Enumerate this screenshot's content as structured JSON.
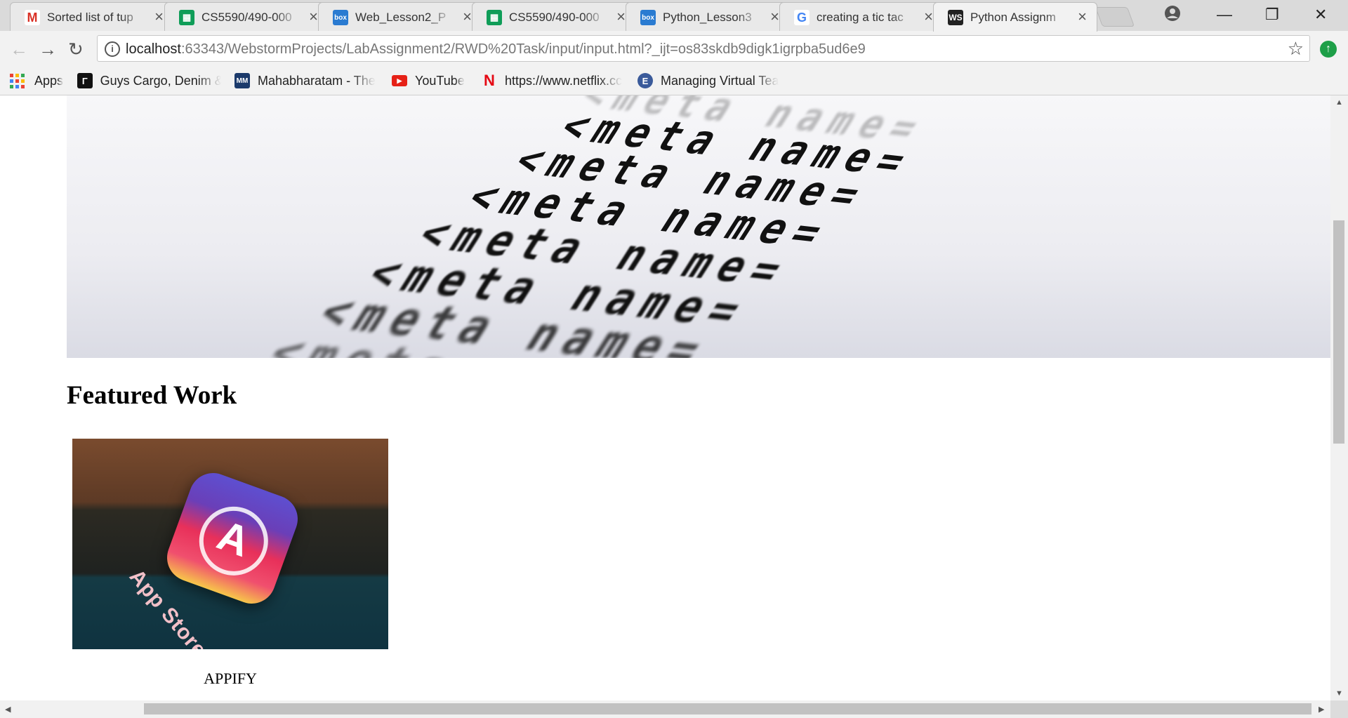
{
  "browser": {
    "tabs": [
      {
        "title": "Sorted list of tup",
        "icon": "gmail-icon",
        "color": "#d93025"
      },
      {
        "title": "CS5590/490-000",
        "icon": "sheets-icon",
        "color": "#0f9d58"
      },
      {
        "title": "Web_Lesson2_P",
        "icon": "box-icon",
        "color": "#2a7bd1"
      },
      {
        "title": "CS5590/490-000",
        "icon": "sheets-icon",
        "color": "#0f9d58"
      },
      {
        "title": "Python_Lesson3",
        "icon": "box-icon",
        "color": "#2a7bd1"
      },
      {
        "title": "creating a tic tac",
        "icon": "google-icon",
        "color": "#4285f4"
      },
      {
        "title": "Python Assignm",
        "icon": "webstorm-icon",
        "color": "#222222"
      }
    ],
    "active_tab_index": 6,
    "url_host": "localhost",
    "url_rest": ":63343/WebstormProjects/LabAssignment2/RWD%20Task/input/input.html?_ijt=os83skdb9digk1igrpba5ud6e9",
    "bookmarks": [
      {
        "label": "Apps",
        "icon": "apps-grid-icon"
      },
      {
        "label": "Guys Cargo, Denim &",
        "icon": "guys-cargo-icon"
      },
      {
        "label": "Mahabharatam - The",
        "icon": "mahabharatam-icon"
      },
      {
        "label": "YouTube",
        "icon": "youtube-icon"
      },
      {
        "label": "https://www.netflix.cc",
        "icon": "netflix-icon"
      },
      {
        "label": "Managing Virtual Tea",
        "icon": "edx-icon"
      }
    ]
  },
  "page": {
    "hero_code_text": "<meta name=",
    "featured_heading": "Featured Work",
    "card": {
      "image_label": "App Store",
      "caption": "APPIFY"
    }
  },
  "icons": {
    "tab_close": "×",
    "back": "←",
    "forward": "→",
    "reload": "↻",
    "star": "☆",
    "minimize": "—",
    "restore": "❐",
    "close": "✕",
    "info": "i"
  }
}
